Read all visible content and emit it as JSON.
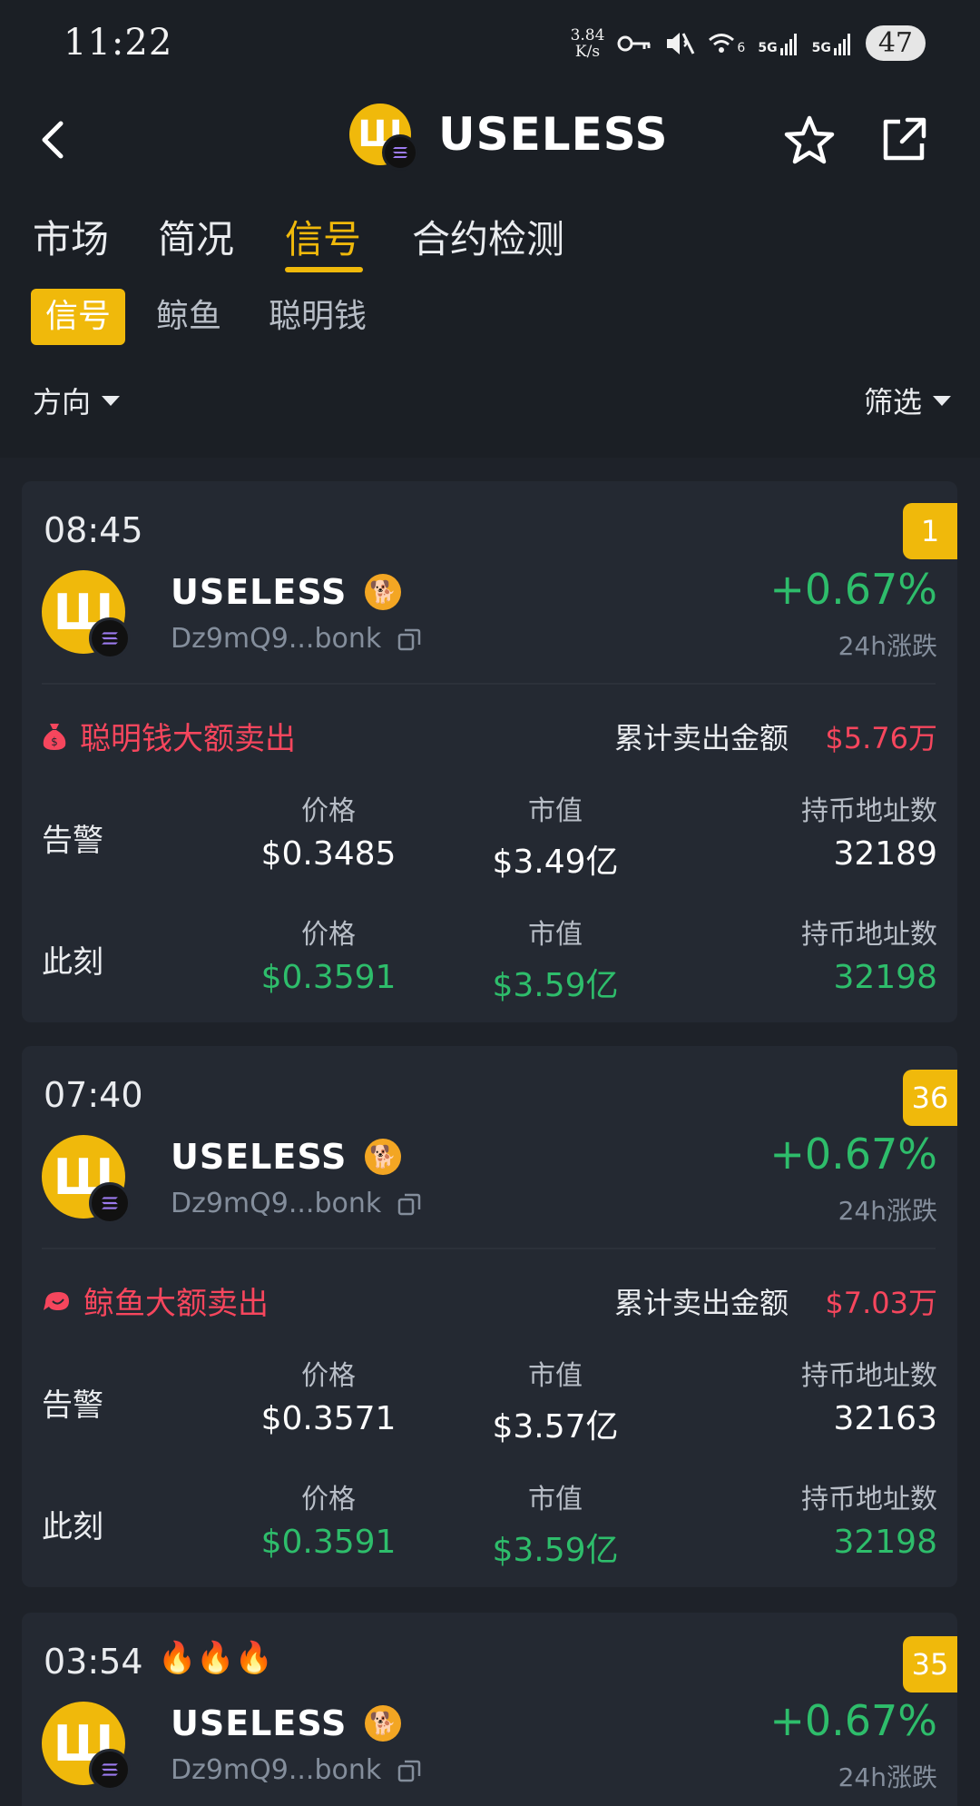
{
  "status_bar": {
    "time": "11:22",
    "net_speed_value": "3.84",
    "net_speed_unit": "K/s",
    "signal_label_1": "5G",
    "signal_label_2": "5G",
    "wifi_label": "6",
    "battery": "47"
  },
  "header": {
    "title": "USELESS",
    "back_icon": "chevron-left-icon",
    "favorite_icon": "star-icon",
    "share_icon": "share-icon"
  },
  "main_tabs": [
    {
      "label": "市场"
    },
    {
      "label": "简况"
    },
    {
      "label": "信号",
      "active": true
    },
    {
      "label": "合约检测"
    }
  ],
  "sub_tabs": [
    {
      "label": "信号",
      "active": true
    },
    {
      "label": "鲸鱼"
    },
    {
      "label": "聪明钱"
    }
  ],
  "filters": {
    "direction": "方向",
    "filter": "筛选"
  },
  "colors": {
    "accent": "#f0b90b",
    "up": "#2ebd6b",
    "down": "#f6465d",
    "background": "#1e2229",
    "card": "#242932"
  },
  "cards": [
    {
      "time": "08:45",
      "rank": "1",
      "token_name": "USELESS",
      "address": "Dz9mQ9...bonk",
      "change": "+0.67%",
      "change_label": "24h涨跌",
      "signal_type": "聪明钱大额卖出",
      "signal_icon": "money-bag-icon",
      "cum_label": "累计卖出金额",
      "cum_value": "$5.76万",
      "headers": {
        "price": "价格",
        "mcap": "市值",
        "holders": "持币地址数"
      },
      "alert": {
        "label": "告警",
        "price": "$0.3485",
        "mcap": "$3.49亿",
        "holders": "32189"
      },
      "now": {
        "label": "此刻",
        "price": "$0.3591",
        "mcap": "$3.59亿",
        "holders": "32198"
      }
    },
    {
      "time": "07:40",
      "rank": "36",
      "token_name": "USELESS",
      "address": "Dz9mQ9...bonk",
      "change": "+0.67%",
      "change_label": "24h涨跌",
      "signal_type": "鲸鱼大额卖出",
      "signal_icon": "whale-icon",
      "cum_label": "累计卖出金额",
      "cum_value": "$7.03万",
      "headers": {
        "price": "价格",
        "mcap": "市值",
        "holders": "持币地址数"
      },
      "alert": {
        "label": "告警",
        "price": "$0.3571",
        "mcap": "$3.57亿",
        "holders": "32163"
      },
      "now": {
        "label": "此刻",
        "price": "$0.3591",
        "mcap": "$3.59亿",
        "holders": "32198"
      }
    },
    {
      "time": "03:54",
      "fires": "🔥🔥🔥",
      "rank": "35",
      "token_name": "USELESS",
      "address": "Dz9mQ9...bonk",
      "change": "+0.67%",
      "change_label": "24h涨跌"
    }
  ]
}
